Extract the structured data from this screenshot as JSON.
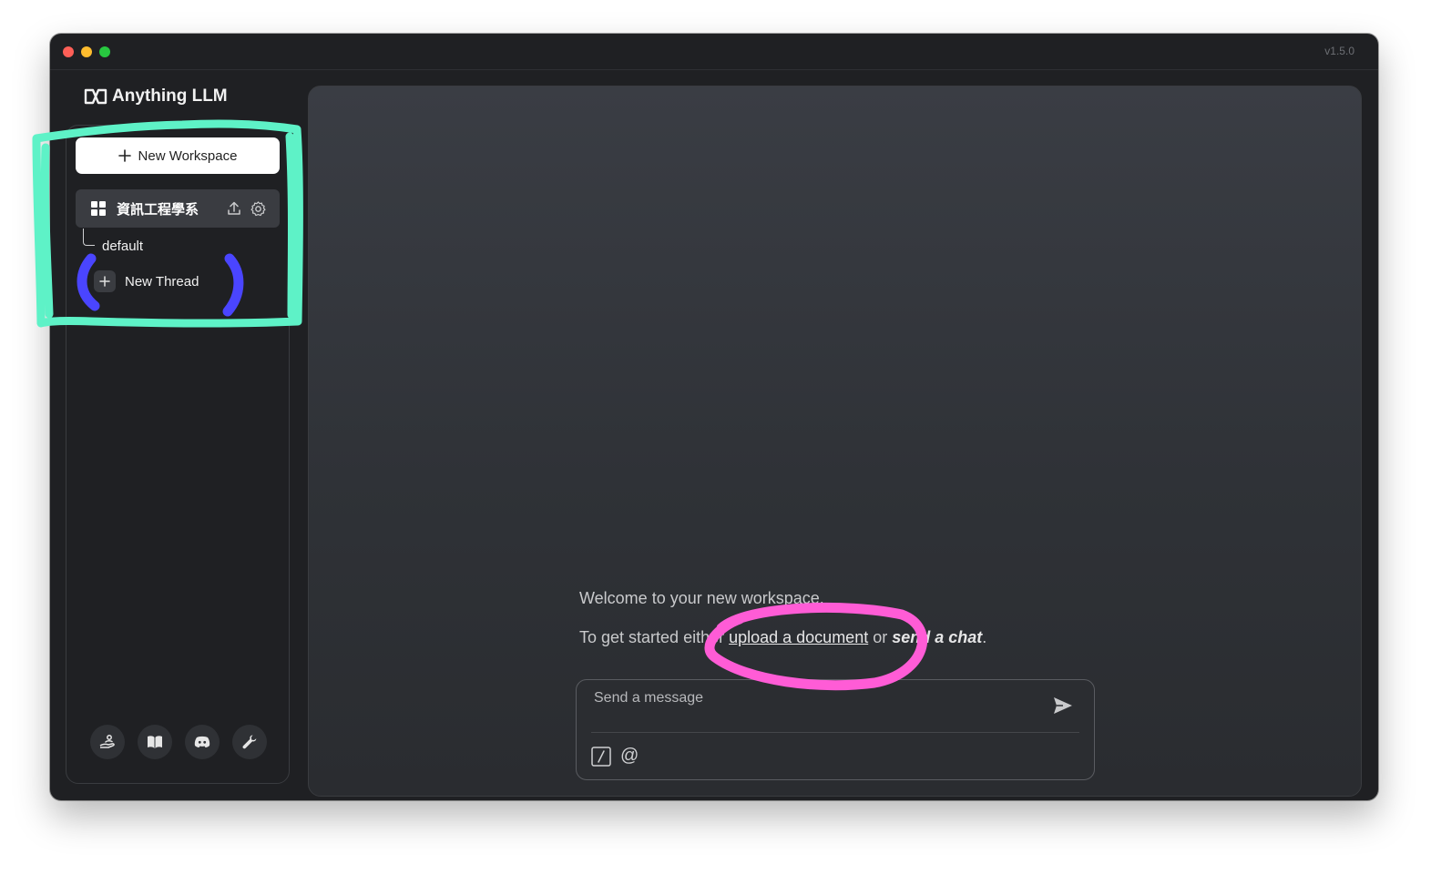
{
  "window": {
    "version": "v1.5.0",
    "traffic_lights": {
      "close": "#fe5f57",
      "minimize": "#febc2e",
      "maximize": "#28c840"
    }
  },
  "sidebar": {
    "logo_text": "Anything LLM",
    "new_workspace_label": "New Workspace",
    "workspace": {
      "name": "資訊工程學系"
    },
    "threads": [
      {
        "label": "default"
      }
    ],
    "new_thread_label": "New Thread",
    "footer_icons": [
      "community-hub-icon",
      "docs-book-icon",
      "discord-icon",
      "settings-wrench-icon"
    ]
  },
  "main": {
    "welcome_text": "Welcome to your new workspace.",
    "getstarted_prefix": "To get started either ",
    "upload_link": "upload a document",
    "middle_text": " or ",
    "send_chat_link": "send a chat",
    "suffix": ".",
    "chat_placeholder": "Send a message"
  },
  "annotations": {
    "teal": "#5ef2c7",
    "blue": "#4a45ff",
    "pink": "#ff5cd6"
  }
}
